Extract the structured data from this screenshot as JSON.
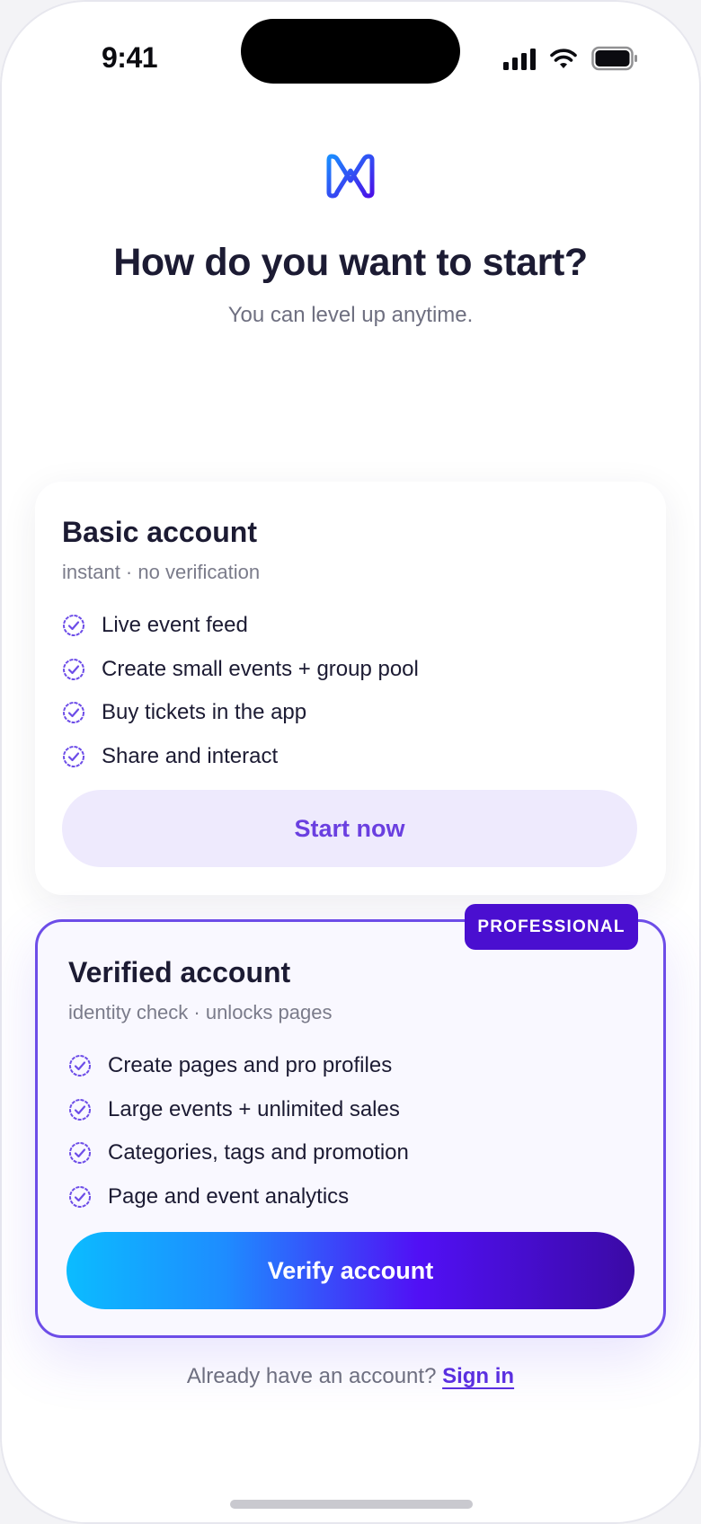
{
  "status_bar": {
    "time": "9:41"
  },
  "header": {
    "title": "How do you want to start?",
    "subtitle": "You can level up anytime."
  },
  "basic_card": {
    "title": "Basic account",
    "subtitle": "instant · no verification",
    "features": [
      "Live event feed",
      "Create small events + group pool",
      "Buy tickets in the app",
      "Share and interact"
    ],
    "button_label": "Start now"
  },
  "verified_card": {
    "badge": "PROFESSIONAL",
    "title": "Verified account",
    "subtitle": "identity check · unlocks pages",
    "features": [
      "Create pages and pro profiles",
      "Large events + unlimited sales",
      "Categories, tags and promotion",
      "Page and event analytics"
    ],
    "button_label": "Verify account"
  },
  "footer": {
    "prompt": "Already have an account?",
    "link_label": "Sign in"
  },
  "colors": {
    "accent": "#6d4de8",
    "badge": "#4a0fd0",
    "title": "#1c1b33",
    "muted": "#6e6f80",
    "button_soft": "#eeeafd",
    "gradient_start": "#0bbcff",
    "gradient_end": "#3b0aa5"
  },
  "icons": [
    "signal-icon",
    "wifi-icon",
    "battery-icon",
    "app-logo-icon",
    "check-badge-icon"
  ]
}
